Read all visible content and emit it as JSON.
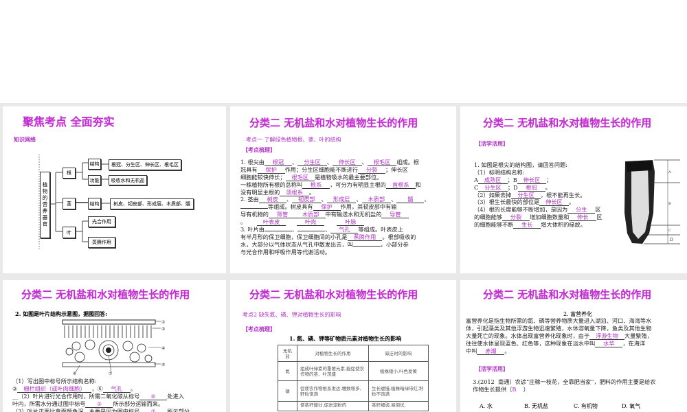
{
  "slides": [
    {
      "title": "聚焦考点  全面夯实",
      "section": "知识网络",
      "diagram": {
        "root": "植物的营养器官",
        "gen": "根",
        "jing": "茎",
        "ye": "叶",
        "gen_structure": "结构",
        "gen_function": "功能",
        "gen_structure_detail": "根冠、分生区、伸长区、根毛区",
        "gen_function_detail": "吸收水和无机盐",
        "jing_structure": "结构",
        "jing_structure_detail": "树皮、韧皮部、形成层、木质部、髓",
        "ye_photosynthesis": "光合作用",
        "ye_transpiration": "蒸腾作用"
      }
    },
    {
      "title": "分类二  无机盐和水对植物生长的作用",
      "point": "考点一   了解绿色植物根、茎、叶的结构",
      "tag": "【考点梳理】",
      "lines": [
        [
          {
            "t": "1. 根尖由"
          },
          {
            "a": "根冠"
          },
          {
            "t": "、"
          },
          {
            "a": "分生区"
          },
          {
            "t": "、"
          },
          {
            "a": "伸长区"
          },
          {
            "t": "、"
          },
          {
            "a": "根毛区"
          },
          {
            "t": "组成。根"
          }
        ],
        [
          {
            "t": "冠具有"
          },
          {
            "a": "保护"
          },
          {
            "t": "作用；分生区细胞能不断进行"
          },
          {
            "a": "分裂"
          },
          {
            "t": "；伸长区"
          }
        ],
        [
          {
            "t": "细胞能较快伸长；"
          },
          {
            "a": "根毛区"
          },
          {
            "t": "是植物吸水的最主要部位。"
          }
        ],
        [
          {
            "t": "一株植物所有根的总称叫"
          },
          {
            "a": "根系"
          },
          {
            "t": "，可分为有明显主根的"
          },
          {
            "a": "直根系"
          },
          {
            "t": "和"
          }
        ],
        [
          {
            "t": "没有明显主根的"
          },
          {
            "a": "须根系"
          },
          {
            "t": "。"
          }
        ],
        [
          {
            "t": "2. 茎由"
          },
          {
            "a": "树皮"
          },
          {
            "t": "、"
          },
          {
            "a": "韧皮部"
          },
          {
            "t": "、"
          },
          {
            "a": "形成层"
          },
          {
            "t": "、"
          },
          {
            "a": "木质部"
          },
          {
            "t": "、"
          },
          {
            "a": "髓"
          },
          {
            "t": "、"
          }
        ],
        [
          {
            "a": "      "
          },
          {
            "t": "等组成。树皮具有"
          },
          {
            "a": "保护"
          },
          {
            "t": "作用，其韧皮部中有输"
          }
        ],
        [
          {
            "t": "导有机物的"
          },
          {
            "a": "筛管"
          },
          {
            "a": "木质部"
          },
          {
            "t": "中有输送水和无机盐的"
          },
          {
            "a": "导管"
          }
        ],
        [
          {
            "t": "。      "
          },
          {
            "a": "叶表皮"
          },
          {
            "t": "      "
          },
          {
            "a": "叶肉"
          },
          {
            "t": "       "
          },
          {
            "a": "叶脉"
          }
        ],
        [
          {
            "t": "3. 叶片由"
          },
          {
            "a": "      "
          },
          {
            "t": "、"
          },
          {
            "a": "      "
          },
          {
            "t": "、"
          },
          {
            "a": "气孔"
          },
          {
            "t": "等组成。叶表皮上"
          }
        ],
        [
          {
            "t": "有半月形的保卫细胞，保卫细胞间的小孔是"
          },
          {
            "a": "蒸腾作用"
          },
          {
            "t": "。根部吸收的"
          }
        ],
        [
          {
            "t": "水，大部分以气体状态从气孔中散发出去，叫"
          },
          {
            "a": "      "
          },
          {
            "t": "，小部分参"
          }
        ],
        [
          {
            "t": "与光合作用和呼吸作用等代谢活动。"
          }
        ]
      ]
    },
    {
      "title": "分类二  无机盐和水对植物生长的作用",
      "tag": "【活学活用】",
      "lines": [
        [
          {
            "t": "1. 如图是根尖的结构图，请回答问题:"
          }
        ],
        [
          {
            "t": "（1）标明结构名称:"
          }
        ],
        [
          {
            "t": "A"
          },
          {
            "a": "成熟区"
          },
          {
            "t": "；B"
          },
          {
            "a": "伸长区"
          },
          {
            "t": "；"
          }
        ],
        [
          {
            "t": "C"
          },
          {
            "a": "分生区"
          },
          {
            "t": "；D"
          },
          {
            "a": "根冠"
          },
          {
            "t": "。"
          }
        ],
        [
          {
            "t": "（2）如果去掉"
          },
          {
            "a": "分生区"
          },
          {
            "t": "，根不能再生长。"
          }
        ],
        [
          {
            "t": "（3）根生长最快的部位是"
          },
          {
            "a": "伸长区"
          },
          {
            "t": "。"
          }
        ],
        [
          {
            "t": "（4）根的长度能够不断增加，是因为"
          },
          {
            "a": "分生"
          },
          {
            "t": "区"
          }
        ],
        [
          {
            "t": "的细胞能够"
          },
          {
            "a": "分裂"
          },
          {
            "t": "增加细胞数量和"
          },
          {
            "a": "伸长"
          },
          {
            "t": "区"
          }
        ],
        [
          {
            "t": "的细胞能够不断"
          },
          {
            "a": "生长"
          },
          {
            "t": "增大体积的缘故。"
          }
        ]
      ],
      "figure_labels": [
        "A",
        "B",
        "C",
        "D"
      ]
    },
    {
      "title": "分类二  无机盐和水对植物生长的作用",
      "question": "2. 如图是叶片结构示意图，据图回答:",
      "figure_labels": [
        "①",
        "②",
        "④",
        "⑤",
        "⑥",
        "⑦"
      ],
      "lines": [
        [
          {
            "t": "（1）写出图中标号所示结构名称:"
          }
        ],
        [
          {
            "t": "②"
          },
          {
            "a": "栅栏组织（或叶肉细胞）"
          },
          {
            "t": "，⑥"
          },
          {
            "a": "气孔"
          },
          {
            "t": "。"
          }
        ],
        [
          {
            "t": "__（2）叶片进行光合作用时，所需二氧化碳从标号"
          },
          {
            "a": "⑥"
          },
          {
            "t": "处进入"
          }
        ],
        [
          {
            "t": "叶内，所需水分通过图中标号"
          },
          {
            "a": "③"
          },
          {
            "t": "所示部分运输而来。"
          }
        ],
        [
          {
            "t": "（3）叶片正面比背面颜色深，主要是因为图中标号"
          },
          {
            "a": "⑦"
          },
          {
            "t": "所示部分"
          }
        ]
      ]
    },
    {
      "title": "分类二  无机盐和水对植物生长的作用",
      "point": "考点2    缺失氮、磷、钾对植物生长的影响",
      "tag": "【考点梳理】",
      "heading": "1. 氮、磷、钾等矿物质元素对植物生长的影响",
      "table": {
        "headers": [
          "无机盐",
          "对植物生长的作用",
          "缺乏时的影响"
        ],
        "rows": [
          [
            "氮",
            "组成叶绿素的重要元素,能促使农作物的茎、叶茂盛",
            "植株矮小,叶色发黄"
          ],
          [
            "磷",
            "促使农作物根系发达,穗数增多,籽粒饱满",
            "生长缓慢,植株暗绿带红,籽粒不饱满"
          ],
          [
            "",
            "使茎秆健壮,促进淀粉的",
            "茎秆细弱,易倒伏,"
          ]
        ]
      }
    },
    {
      "title": "分类二  无机盐和水对植物生长的作用",
      "heading": "2. 富营养化",
      "lines": [
        [
          {
            "t": "富营养化是指生物所需的氮、磷等营养物质大量进入湖泊、河口、海湾等水"
          }
        ],
        [
          {
            "t": "体，引起藻类及其他浮游生物迅速繁殖，水体溶氧量下降，鱼类及其他生物"
          }
        ],
        [
          {
            "t": "大量死亡的现象。水体出现富营养化现象时，由于"
          },
          {
            "a": "浮游生物"
          },
          {
            "t": "大量繁殖，"
          }
        ],
        [
          {
            "t": "往往使水体呈现蓝色、红色等，这种现象在淡水中叫"
          },
          {
            "a": "水华"
          },
          {
            "t": "，在海洋"
          }
        ],
        [
          {
            "t": "中叫"
          },
          {
            "a": "赤潮"
          },
          {
            "t": "。"
          }
        ]
      ],
      "tag": "【活学活用】",
      "qlines": [
        [
          {
            "t": "3.(2012  南通）农谚“庄稼一枝花，全靠肥当家”，肥料的作用主要是给农"
          }
        ],
        [
          {
            "t": "作物生长提供（"
          },
          {
            "m": "B"
          },
          {
            "t": "    ）"
          }
        ]
      ],
      "options": [
        "A. 水",
        "B. 无机盐",
        "C. 有机物",
        "D. 氧气"
      ]
    }
  ],
  "colors": {
    "title": "#c22fd0",
    "answer": "#b02ec8",
    "background": "#e9e9e9"
  }
}
